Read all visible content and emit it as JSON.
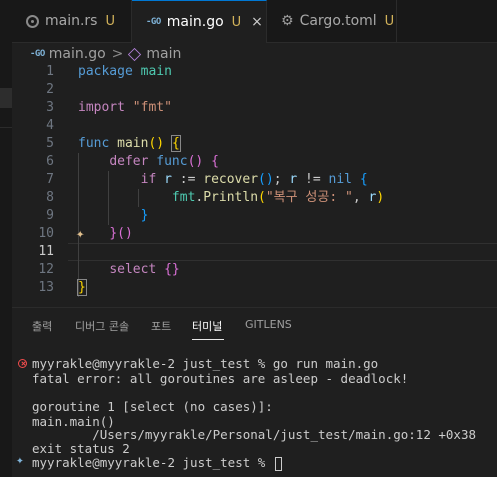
{
  "tabs": [
    {
      "name": "main.rs",
      "status": "U",
      "icon": "rust-icon",
      "active": false
    },
    {
      "name": "main.go",
      "status": "U",
      "icon": "go-icon",
      "active": true,
      "close": "×"
    },
    {
      "name": "Cargo.toml",
      "status": "U",
      "icon": "gear-icon",
      "active": false
    }
  ],
  "breadcrumb": {
    "file": "main.go",
    "symbol": "main",
    "sep": ">",
    "go_icon_text": "-GO"
  },
  "editor": {
    "current_line": 11,
    "line_numbers": [
      "1",
      "2",
      "3",
      "4",
      "5",
      "6",
      "7",
      "8",
      "9",
      "10",
      "11",
      "12",
      "13"
    ],
    "code": {
      "l1_kw": "package",
      "l1_name": " main",
      "l3_kw": "import",
      "l3_str": "\"fmt\"",
      "l5_kw": "func",
      "l5_fn": "main",
      "l5_parens": "()",
      "l5_brace": "{",
      "l6_kw": "defer",
      "l6_fn": "func",
      "l6_parens": "()",
      "l6_brace": "{",
      "l7_if": "if",
      "l7_r": "r",
      "l7_assign": " := ",
      "l7_fn": "recover",
      "l7_parens": "()",
      "l7_semi": "; ",
      "l7_r2": "r",
      "l7_neq": " != ",
      "l7_nil": "nil",
      "l7_brace": "{",
      "l8_pkg": "fmt",
      "l8_dot": ".",
      "l8_fn": "Println",
      "l8_open": "(",
      "l8_str": "\"복구 성공: \"",
      "l8_comma": ", ",
      "l8_r": "r",
      "l8_close": ")",
      "l9_brace": "}",
      "l10_brace": "}",
      "l10_parens": "()",
      "l12_kw": "select",
      "l12_braces": "{}",
      "l13_brace": "}"
    },
    "sparkle": "✦"
  },
  "panel": {
    "tabs": [
      "출력",
      "디버그 콘솔",
      "포트",
      "터미널",
      "GITLENS"
    ],
    "active_tab": "터미널"
  },
  "terminal": {
    "lines": [
      "myyrakle@myyrakle-2 just_test % go run main.go",
      "fatal error: all goroutines are asleep - deadlock!",
      "",
      "goroutine 1 [select (no cases)]:",
      "main.main()",
      "        /Users/myyrakle/Personal/just_test/main.go:12 +0x38",
      "exit status 2",
      "myyrakle@myyrakle-2 just_test % "
    ]
  },
  "colors": {
    "accent": "#0078d4",
    "modified": "#d2b25a",
    "error": "#f14c4c"
  }
}
